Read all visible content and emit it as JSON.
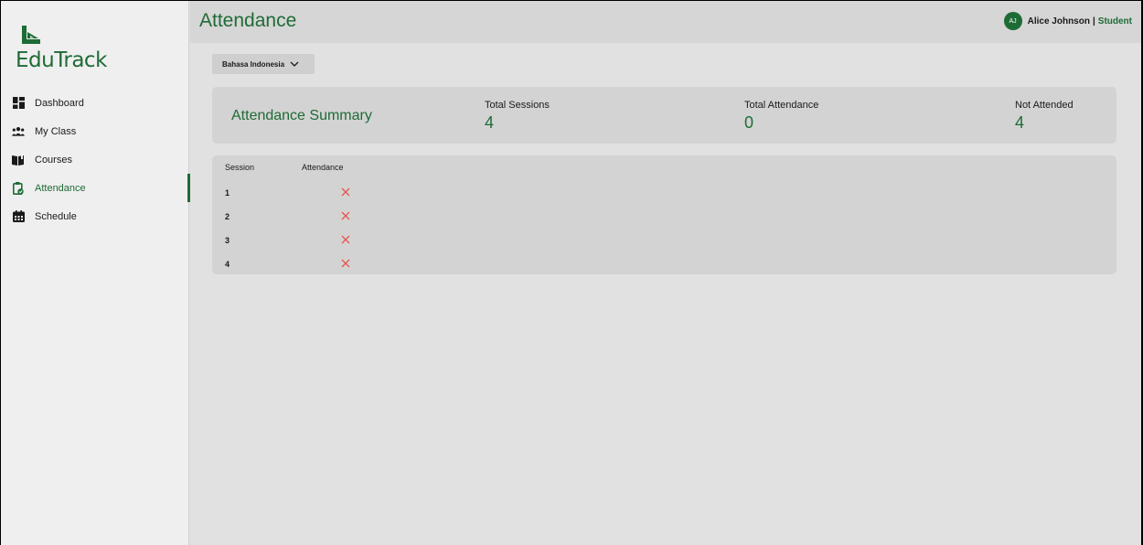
{
  "app": {
    "name": "EduTrack"
  },
  "sidebar": {
    "items": [
      {
        "label": "Dashboard",
        "icon": "dashboard-icon"
      },
      {
        "label": "My Class",
        "icon": "group-icon"
      },
      {
        "label": "Courses",
        "icon": "book-icon"
      },
      {
        "label": "Attendance",
        "icon": "attendance-icon",
        "active": true
      },
      {
        "label": "Schedule",
        "icon": "calendar-icon"
      }
    ]
  },
  "header": {
    "title": "Attendance",
    "user": {
      "initials": "AJ",
      "name": "Alice Johnson",
      "separator": "|",
      "role": "Student"
    }
  },
  "course_select": {
    "value": "Bahasa Indonesia"
  },
  "summary": {
    "title": "Attendance Summary",
    "stats": [
      {
        "label": "Total Sessions",
        "value": "4"
      },
      {
        "label": "Total Attendance",
        "value": "0"
      },
      {
        "label": "Not Attended",
        "value": "4"
      }
    ]
  },
  "table": {
    "headers": {
      "session": "Session",
      "attendance": "Attendance"
    },
    "rows": [
      {
        "session": "1",
        "attended": false
      },
      {
        "session": "2",
        "attended": false
      },
      {
        "session": "3",
        "attended": false
      },
      {
        "session": "4",
        "attended": false
      }
    ]
  },
  "colors": {
    "brand": "#1e6b36",
    "absent": "#e4574b"
  }
}
